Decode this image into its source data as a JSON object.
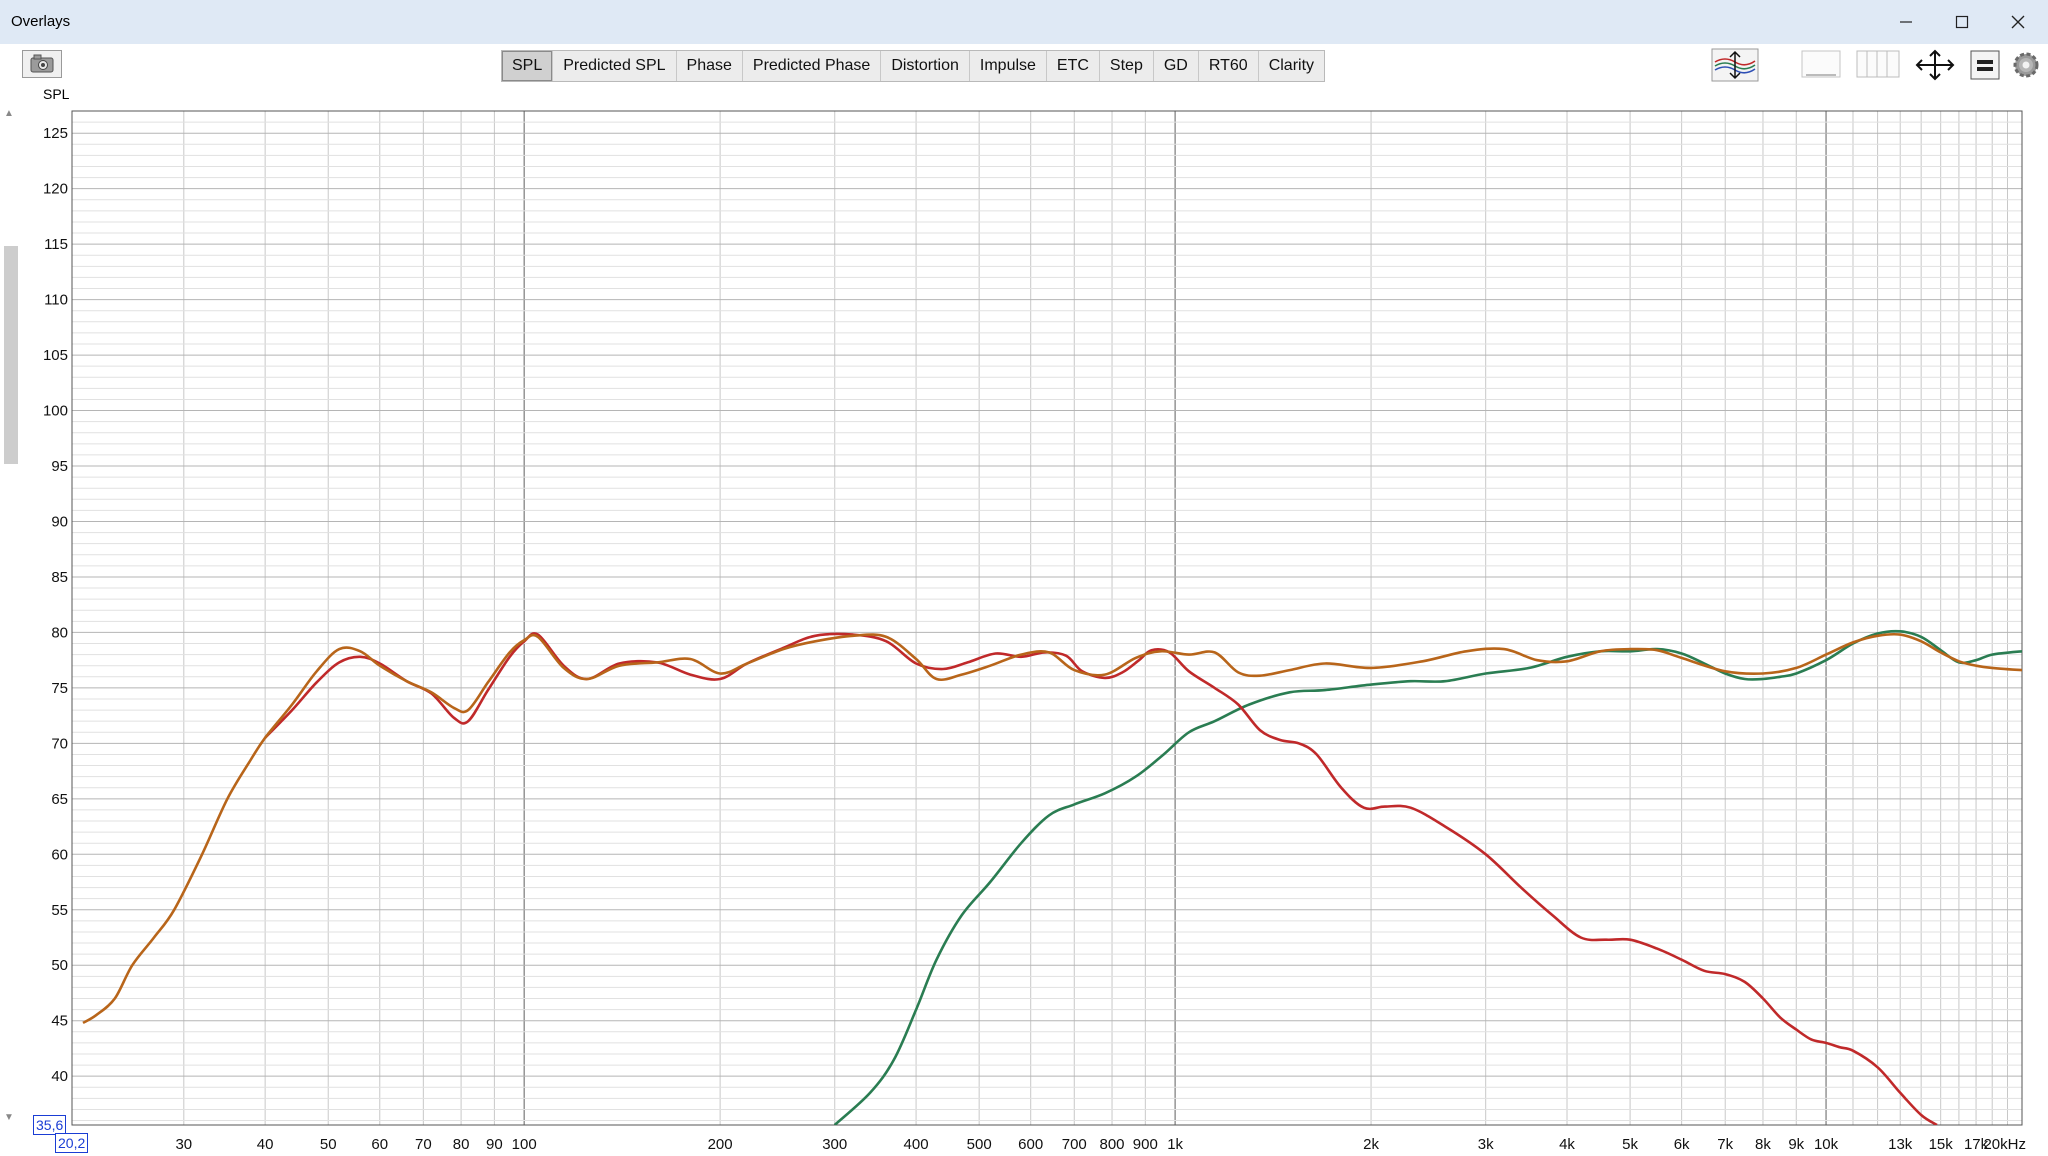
{
  "window": {
    "title": "Overlays"
  },
  "tabs": [
    "SPL",
    "Predicted SPL",
    "Phase",
    "Predicted Phase",
    "Distortion",
    "Impulse",
    "ETC",
    "Step",
    "GD",
    "RT60",
    "Clarity"
  ],
  "active_tab": "SPL",
  "axis": {
    "y_title": "SPL"
  },
  "cursor": {
    "y_readout": "35,6",
    "x_readout": "20,2"
  },
  "chart_data": {
    "type": "line",
    "xscale": "log",
    "xlim": [
      20.2,
      20000
    ],
    "ylim": [
      35.6,
      127
    ],
    "grid": true,
    "yticks": [
      40,
      45,
      50,
      55,
      60,
      65,
      70,
      75,
      80,
      85,
      90,
      95,
      100,
      105,
      110,
      115,
      120,
      125
    ],
    "xticks": [
      {
        "v": 30,
        "label": "30"
      },
      {
        "v": 40,
        "label": "40"
      },
      {
        "v": 50,
        "label": "50"
      },
      {
        "v": 60,
        "label": "60"
      },
      {
        "v": 70,
        "label": "70"
      },
      {
        "v": 80,
        "label": "80"
      },
      {
        "v": 90,
        "label": "90"
      },
      {
        "v": 100,
        "label": "100"
      },
      {
        "v": 200,
        "label": "200"
      },
      {
        "v": 300,
        "label": "300"
      },
      {
        "v": 400,
        "label": "400"
      },
      {
        "v": 500,
        "label": "500"
      },
      {
        "v": 600,
        "label": "600"
      },
      {
        "v": 700,
        "label": "700"
      },
      {
        "v": 800,
        "label": "800"
      },
      {
        "v": 900,
        "label": "900"
      },
      {
        "v": 1000,
        "label": "1k"
      },
      {
        "v": 2000,
        "label": "2k"
      },
      {
        "v": 3000,
        "label": "3k"
      },
      {
        "v": 4000,
        "label": "4k"
      },
      {
        "v": 5000,
        "label": "5k"
      },
      {
        "v": 6000,
        "label": "6k"
      },
      {
        "v": 7000,
        "label": "7k"
      },
      {
        "v": 8000,
        "label": "8k"
      },
      {
        "v": 9000,
        "label": "9k"
      },
      {
        "v": 10000,
        "label": "10k"
      },
      {
        "v": 13000,
        "label": "13k"
      },
      {
        "v": 15000,
        "label": "15k"
      },
      {
        "v": 17000,
        "label": "17k"
      },
      {
        "v": 20000,
        "label": "20kHz"
      }
    ],
    "series": [
      {
        "color": "#2a7d52",
        "x": [
          300,
          340,
          370,
          400,
          430,
          470,
          520,
          580,
          640,
          700,
          780,
          870,
          960,
          1050,
          1150,
          1300,
          1500,
          1700,
          2000,
          2300,
          2600,
          3000,
          3500,
          4000,
          4500,
          5000,
          5500,
          6000,
          6500,
          7000,
          7500,
          8000,
          8500,
          9000,
          10000,
          11000,
          12000,
          13000,
          14000,
          15000,
          16000,
          17000,
          18000,
          20000
        ],
        "y": [
          35.6,
          38.5,
          41.5,
          46,
          50.5,
          54.5,
          57.5,
          61,
          63.5,
          64.5,
          65.5,
          67,
          69,
          71,
          72,
          73.5,
          74.6,
          74.8,
          75.3,
          75.6,
          75.6,
          76.3,
          76.8,
          77.8,
          78.3,
          78.3,
          78.5,
          78.1,
          77.2,
          76.3,
          75.8,
          75.8,
          76,
          76.3,
          77.5,
          79,
          79.9,
          80.1,
          79.6,
          78.4,
          77.3,
          77.5,
          78,
          78.3
        ]
      },
      {
        "color": "#c0292a",
        "x": [
          40,
          44,
          48,
          52,
          56,
          60,
          66,
          72,
          78,
          82,
          88,
          95,
          100,
          105,
          115,
          125,
          140,
          160,
          180,
          200,
          220,
          250,
          280,
          320,
          360,
          400,
          440,
          480,
          530,
          580,
          630,
          680,
          720,
          780,
          830,
          880,
          920,
          980,
          1050,
          1150,
          1250,
          1350,
          1450,
          1550,
          1650,
          1800,
          1950,
          2100,
          2300,
          2600,
          3000,
          3400,
          3800,
          4200,
          4600,
          5000,
          5500,
          6000,
          6500,
          7000,
          7500,
          8000,
          8500,
          9000,
          9500,
          10000,
          10500,
          11000,
          12000,
          13000,
          14000,
          14800
        ],
        "y": [
          70.5,
          73,
          75.5,
          77.3,
          77.8,
          77.2,
          75.6,
          74.5,
          72.3,
          72,
          74.8,
          77.8,
          79.2,
          79.8,
          77,
          75.8,
          77.2,
          77.3,
          76.2,
          75.8,
          77.2,
          78.6,
          79.7,
          79.8,
          79.2,
          77.2,
          76.7,
          77.3,
          78.1,
          77.8,
          78.2,
          77.9,
          76.5,
          75.9,
          76.4,
          77.5,
          78.4,
          78.2,
          76.5,
          75,
          73.5,
          71.2,
          70.3,
          70,
          69,
          66,
          64.2,
          64.3,
          64.2,
          62.5,
          60,
          57,
          54.5,
          52.5,
          52.3,
          52.3,
          51.5,
          50.5,
          49.5,
          49.2,
          48.5,
          47,
          45.3,
          44.2,
          43.3,
          43,
          42.6,
          42.3,
          40.8,
          38.5,
          36.5,
          35.6
        ]
      },
      {
        "color": "#b8651a",
        "x": [
          21,
          22,
          23.5,
          25,
          27,
          29,
          32,
          35,
          38,
          40,
          44,
          48,
          52,
          56,
          60,
          66,
          72,
          78,
          82,
          88,
          95,
          100,
          105,
          115,
          125,
          140,
          160,
          180,
          200,
          220,
          250,
          280,
          320,
          360,
          400,
          430,
          470,
          520,
          580,
          640,
          700,
          780,
          870,
          950,
          1050,
          1150,
          1250,
          1350,
          1500,
          1700,
          2000,
          2400,
          2800,
          3200,
          3600,
          4000,
          4500,
          5000,
          5500,
          6000,
          7000,
          8000,
          9000,
          10000,
          11000,
          12000,
          13000,
          14000,
          15000,
          16000,
          17000,
          18000,
          20000
        ],
        "y": [
          44.8,
          45.5,
          47,
          50,
          52.5,
          55,
          60,
          65,
          68.5,
          70.5,
          73.5,
          76.5,
          78.5,
          78.3,
          77,
          75.6,
          74.6,
          73.2,
          73,
          75.5,
          78.2,
          79.3,
          79.6,
          76.8,
          75.8,
          77,
          77.3,
          77.6,
          76.3,
          77.2,
          78.5,
          79.2,
          79.7,
          79.6,
          77.6,
          75.8,
          76.2,
          77,
          78,
          78.2,
          76.6,
          76.2,
          77.7,
          78.3,
          78,
          78.2,
          76.4,
          76.1,
          76.6,
          77.2,
          76.8,
          77.4,
          78.3,
          78.5,
          77.5,
          77.4,
          78.3,
          78.5,
          78.4,
          77.7,
          76.5,
          76.3,
          76.8,
          78,
          79.1,
          79.7,
          79.8,
          79.2,
          78.2,
          77.4,
          77.0,
          76.8,
          76.6
        ]
      }
    ]
  }
}
